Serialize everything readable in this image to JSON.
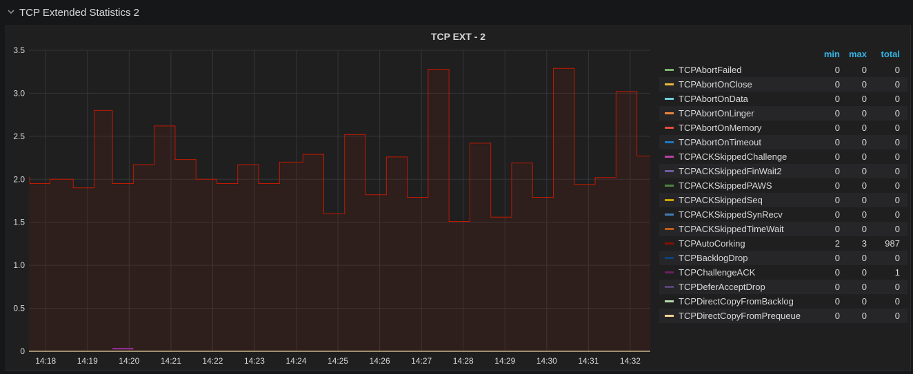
{
  "row": {
    "title": "TCP Extended Statistics 2"
  },
  "panel": {
    "title": "TCP EXT - 2"
  },
  "legend": {
    "headers": {
      "min": "min",
      "max": "max",
      "total": "total"
    },
    "items": [
      {
        "label": "TCPAbortFailed",
        "color": "#7eb26d",
        "min": "0",
        "max": "0",
        "total": "0"
      },
      {
        "label": "TCPAbortOnClose",
        "color": "#eab839",
        "min": "0",
        "max": "0",
        "total": "0"
      },
      {
        "label": "TCPAbortOnData",
        "color": "#6ed0e0",
        "min": "0",
        "max": "0",
        "total": "0"
      },
      {
        "label": "TCPAbortOnLinger",
        "color": "#ef843c",
        "min": "0",
        "max": "0",
        "total": "0"
      },
      {
        "label": "TCPAbortOnMemory",
        "color": "#e24d42",
        "min": "0",
        "max": "0",
        "total": "0"
      },
      {
        "label": "TCPAbortOnTimeout",
        "color": "#1f78c1",
        "min": "0",
        "max": "0",
        "total": "0"
      },
      {
        "label": "TCPACKSkippedChallenge",
        "color": "#ba43a9",
        "min": "0",
        "max": "0",
        "total": "0"
      },
      {
        "label": "TCPACKSkippedFinWait2",
        "color": "#705da0",
        "min": "0",
        "max": "0",
        "total": "0"
      },
      {
        "label": "TCPACKSkippedPAWS",
        "color": "#508642",
        "min": "0",
        "max": "0",
        "total": "0"
      },
      {
        "label": "TCPACKSkippedSeq",
        "color": "#cca300",
        "min": "0",
        "max": "0",
        "total": "0"
      },
      {
        "label": "TCPACKSkippedSynRecv",
        "color": "#447ebc",
        "min": "0",
        "max": "0",
        "total": "0"
      },
      {
        "label": "TCPACKSkippedTimeWait",
        "color": "#c15c17",
        "min": "0",
        "max": "0",
        "total": "0"
      },
      {
        "label": "TCPAutoCorking",
        "color": "#890f02",
        "min": "2",
        "max": "3",
        "total": "987"
      },
      {
        "label": "TCPBacklogDrop",
        "color": "#0a437c",
        "min": "0",
        "max": "0",
        "total": "0"
      },
      {
        "label": "TCPChallengeACK",
        "color": "#6d1f62",
        "min": "0",
        "max": "0",
        "total": "1"
      },
      {
        "label": "TCPDeferAcceptDrop",
        "color": "#584477",
        "min": "0",
        "max": "0",
        "total": "0"
      },
      {
        "label": "TCPDirectCopyFromBacklog",
        "color": "#b7dbab",
        "min": "0",
        "max": "0",
        "total": "0"
      },
      {
        "label": "TCPDirectCopyFromPrequeue",
        "color": "#f4d598",
        "min": "0",
        "max": "0",
        "total": "0"
      }
    ]
  },
  "chart_data": {
    "type": "line",
    "title": "TCP EXT - 2",
    "xlabel": "",
    "ylabel": "",
    "ylim": [
      0,
      3.5
    ],
    "yticks": [
      "0",
      "0.5",
      "1.0",
      "1.5",
      "2.0",
      "2.5",
      "3.0",
      "3.5"
    ],
    "xticks": [
      "14:18",
      "14:19",
      "14:20",
      "14:21",
      "14:22",
      "14:23",
      "14:24",
      "14:25",
      "14:26",
      "14:27",
      "14:28",
      "14:29",
      "14:30",
      "14:31",
      "14:32"
    ],
    "grid": true,
    "legend_position": "right",
    "x_start_minute": 17.6,
    "x_end_minute": 32.48,
    "series": [
      {
        "name": "TCPAutoCorking",
        "color": "#bf1b00",
        "fill": true,
        "points": [
          [
            17.6,
            2.02
          ],
          [
            17.62,
            1.95
          ],
          [
            18.1,
            2.0
          ],
          [
            18.66,
            1.9
          ],
          [
            19.16,
            2.8
          ],
          [
            19.6,
            1.95
          ],
          [
            20.1,
            2.17
          ],
          [
            20.6,
            2.62
          ],
          [
            21.1,
            2.23
          ],
          [
            21.6,
            2.0
          ],
          [
            22.1,
            1.95
          ],
          [
            22.6,
            2.17
          ],
          [
            23.1,
            1.95
          ],
          [
            23.6,
            2.2
          ],
          [
            24.16,
            2.29
          ],
          [
            24.66,
            1.6
          ],
          [
            25.16,
            2.52
          ],
          [
            25.66,
            1.82
          ],
          [
            26.16,
            2.26
          ],
          [
            26.66,
            1.79
          ],
          [
            27.16,
            3.28
          ],
          [
            27.66,
            1.51
          ],
          [
            28.16,
            2.42
          ],
          [
            28.66,
            1.56
          ],
          [
            29.16,
            2.19
          ],
          [
            29.66,
            1.79
          ],
          [
            30.16,
            3.29
          ],
          [
            30.66,
            1.94
          ],
          [
            31.16,
            2.02
          ],
          [
            31.66,
            3.02
          ],
          [
            32.16,
            2.27
          ],
          [
            32.48,
            2.27
          ]
        ]
      },
      {
        "name": "TCPChallengeACK",
        "color": "#9b2fa0",
        "fill": false,
        "points": [
          [
            19.6,
            0.03
          ],
          [
            20.1,
            0.03
          ]
        ]
      },
      {
        "name": "TCPDirectCopyFromPrequeue",
        "color": "#f4d598",
        "fill": false,
        "points": [
          [
            17.6,
            0
          ],
          [
            32.48,
            0
          ]
        ]
      }
    ]
  }
}
